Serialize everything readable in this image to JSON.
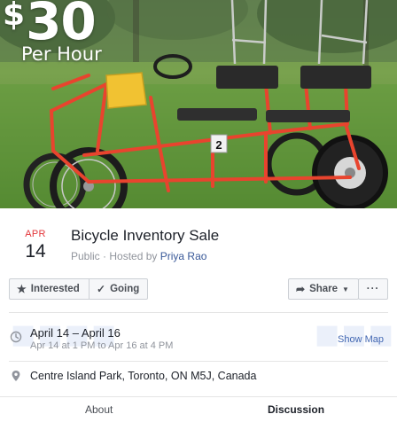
{
  "hero": {
    "price_symbol": "$",
    "price_amount": "30",
    "rate_label": "Per Hour",
    "bike_number": "2"
  },
  "event": {
    "date_month": "Apr",
    "date_day": "14",
    "title": "Bicycle Inventory Sale",
    "privacy": "Public",
    "separator": "·",
    "hosted_by_prefix": "Hosted by",
    "host_name": "Priya Rao"
  },
  "actions": {
    "interested_label": "Interested",
    "going_label": "Going",
    "share_label": "Share",
    "more_label": "···"
  },
  "details": {
    "time_range": "April 14 – April 16",
    "time_detail": "Apr 14 at 1 PM to Apr 16 at 4 PM",
    "location": "Centre Island Park, Toronto, ON M5J, Canada",
    "show_map_label": "Show Map"
  },
  "tabs": [
    {
      "label": "About",
      "active": false
    },
    {
      "label": "Discussion",
      "active": true
    }
  ],
  "icons": {
    "interested": "star-icon",
    "going": "check-icon",
    "share": "share-arrow-icon",
    "time": "clock-icon",
    "location": "map-pin-icon"
  },
  "colors": {
    "date_month": "#e3373b",
    "link": "#385898",
    "map_link": "#4267b2",
    "bike_frame": "#e8442e",
    "grass": "#5c8f3a"
  }
}
